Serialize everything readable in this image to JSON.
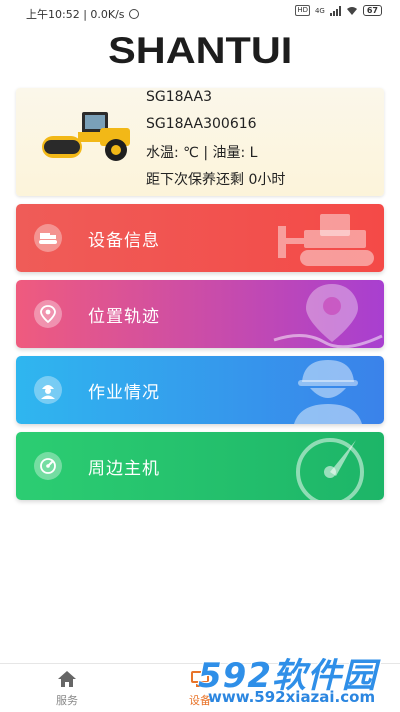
{
  "status_bar": {
    "time_network": "上午10:52 | 0.0K/s",
    "hd_badge": "HD",
    "network_type": "4G",
    "battery": "67",
    "icons": [
      "alarm-icon",
      "signal-icon",
      "wifi-icon",
      "battery-icon"
    ]
  },
  "brand": {
    "logo_text": "SHANTUI"
  },
  "device_info": {
    "model": "SG18AA3",
    "serial": "SG18AA300616",
    "temp_oil": "水温: ℃ | 油量: L",
    "maintenance": "距下次保养还剩 0小时",
    "image_icon": "road-roller-icon"
  },
  "menu": [
    {
      "label": "设备信息",
      "icon": "excavator-icon",
      "color_from": "#ef5c58",
      "color_to": "#f44a47"
    },
    {
      "label": "位置轨迹",
      "icon": "location-pin-icon",
      "color_from": "#ef5b7e",
      "color_to": "#a83fd0"
    },
    {
      "label": "作业情况",
      "icon": "worker-icon",
      "color_from": "#2fb6ef",
      "color_to": "#3a82ea"
    },
    {
      "label": "周边主机",
      "icon": "radar-icon",
      "color_from": "#2ccd72",
      "color_to": "#1db568"
    }
  ],
  "bottom_nav": {
    "items": [
      {
        "label": "服务",
        "icon": "home-icon",
        "active": false
      },
      {
        "label": "设备",
        "icon": "device-icon",
        "active": true
      }
    ],
    "active_color": "#e8742a"
  },
  "watermark": {
    "main": "592软件园",
    "url": "www.592xiazai.com"
  }
}
